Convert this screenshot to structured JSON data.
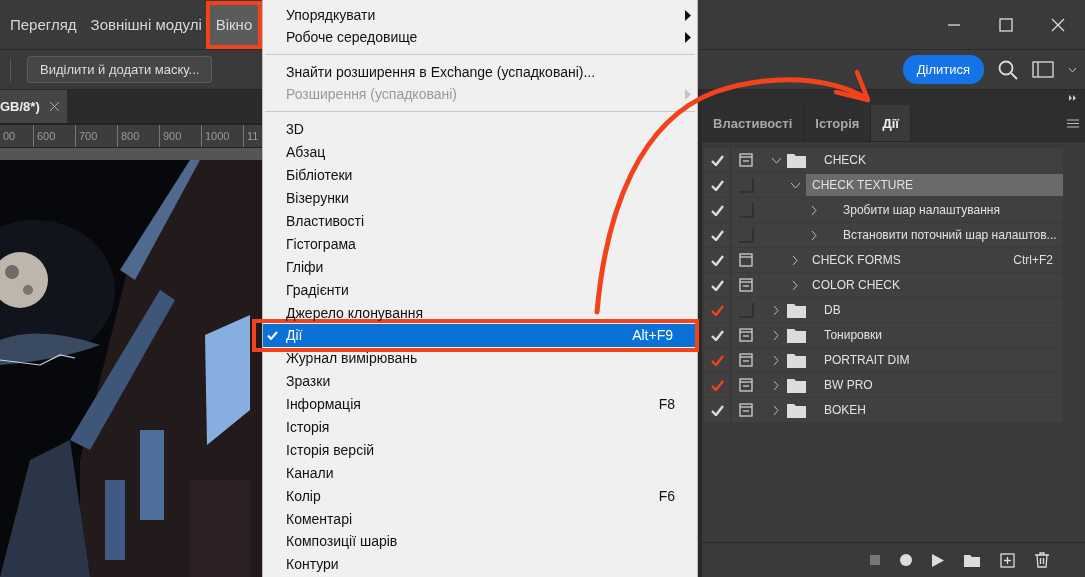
{
  "menubar": [
    {
      "label": "Перегляд",
      "open": false,
      "annotated": false
    },
    {
      "label": "Зовнішні модулі",
      "open": false,
      "annotated": false
    },
    {
      "label": "Вікно",
      "open": true,
      "annotated": true
    }
  ],
  "options_bar": {
    "mask_button": "Виділити й додати маску...",
    "share_button": "Ділитися"
  },
  "document_tab": {
    "title": "GB/8*)"
  },
  "ruler": {
    "labels": [
      "00",
      "600",
      "700",
      "800",
      "900",
      "1000",
      "11"
    ]
  },
  "panel": {
    "tabs": [
      {
        "label": "Властивості",
        "selected": false
      },
      {
        "label": "Історія",
        "selected": false
      },
      {
        "label": "Дії",
        "selected": true
      }
    ],
    "actions": [
      {
        "kind": "set",
        "name": "CHECK",
        "partially_enabled": false,
        "dialog_on": true,
        "dialog_mixed": true,
        "expanded": true,
        "selected": false,
        "children": [
          {
            "kind": "action",
            "name": "CHECK TEXTURE",
            "partially_enabled": false,
            "dialog_on": false,
            "expanded": true,
            "selected": true,
            "children": [
              {
                "kind": "step",
                "name": "Зробити шар налаштування",
                "partially_enabled": false,
                "dialog_on": false,
                "expanded": false,
                "selected": false
              },
              {
                "kind": "step",
                "name": "Встановити поточний шар налаштов...",
                "partially_enabled": false,
                "dialog_on": false,
                "expanded": false,
                "selected": false
              }
            ]
          },
          {
            "kind": "action",
            "name": "CHECK  FORMS",
            "shortcut": "Ctrl+F2",
            "partially_enabled": false,
            "dialog_on": true,
            "dialog_mixed": false,
            "expanded": false,
            "selected": false
          },
          {
            "kind": "action",
            "name": "COLOR CHECK",
            "partially_enabled": false,
            "dialog_on": true,
            "dialog_mixed": true,
            "expanded": false,
            "selected": false
          }
        ]
      },
      {
        "kind": "set",
        "name": "DB",
        "partially_enabled": true,
        "dialog_on": false,
        "expanded": false,
        "selected": false
      },
      {
        "kind": "set",
        "name": "Тонировки",
        "partially_enabled": false,
        "dialog_on": true,
        "dialog_mixed": true,
        "expanded": false,
        "selected": false
      },
      {
        "kind": "set",
        "name": "PORTRAIT DIM",
        "partially_enabled": true,
        "dialog_on": true,
        "dialog_mixed": true,
        "expanded": false,
        "selected": false
      },
      {
        "kind": "set",
        "name": "BW PRO",
        "partially_enabled": true,
        "dialog_on": true,
        "dialog_mixed": true,
        "expanded": false,
        "selected": false
      },
      {
        "kind": "set",
        "name": "BOKEH",
        "partially_enabled": false,
        "dialog_on": true,
        "dialog_mixed": true,
        "expanded": false,
        "selected": false
      }
    ]
  },
  "menu": {
    "groups": [
      [
        {
          "label": "Упорядкувати",
          "submenu": true,
          "disabled": false,
          "checked": false,
          "selected": false,
          "annotated": false
        },
        {
          "label": "Робоче середовище",
          "submenu": true,
          "disabled": false,
          "checked": false,
          "selected": false,
          "annotated": false
        }
      ],
      [
        {
          "label": "Знайти розширення в Exchange (успадковані)...",
          "submenu": false,
          "disabled": false,
          "checked": false,
          "selected": false,
          "annotated": false
        },
        {
          "label": "Розширення (успадковані)",
          "submenu": true,
          "disabled": true,
          "checked": false,
          "selected": false,
          "annotated": false
        }
      ],
      [
        {
          "label": "3D",
          "submenu": false,
          "disabled": false,
          "checked": false,
          "selected": false,
          "annotated": false
        },
        {
          "label": "Абзац",
          "submenu": false,
          "disabled": false,
          "checked": false,
          "selected": false,
          "annotated": false
        },
        {
          "label": "Бібліотеки",
          "submenu": false,
          "disabled": false,
          "checked": false,
          "selected": false,
          "annotated": false
        },
        {
          "label": "Візерунки",
          "submenu": false,
          "disabled": false,
          "checked": false,
          "selected": false,
          "annotated": false
        },
        {
          "label": "Властивості",
          "submenu": false,
          "disabled": false,
          "checked": false,
          "selected": false,
          "annotated": false
        },
        {
          "label": "Гістограма",
          "submenu": false,
          "disabled": false,
          "checked": false,
          "selected": false,
          "annotated": false
        },
        {
          "label": "Гліфи",
          "submenu": false,
          "disabled": false,
          "checked": false,
          "selected": false,
          "annotated": false
        },
        {
          "label": "Градієнти",
          "submenu": false,
          "disabled": false,
          "checked": false,
          "selected": false,
          "annotated": false
        },
        {
          "label": "Джерело клонування",
          "submenu": false,
          "disabled": false,
          "checked": false,
          "selected": false,
          "annotated": false
        },
        {
          "label": "Дії",
          "shortcut": "Alt+F9",
          "submenu": false,
          "disabled": false,
          "checked": true,
          "selected": true,
          "annotated": true
        },
        {
          "label": "Журнал вимірювань",
          "submenu": false,
          "disabled": false,
          "checked": false,
          "selected": false,
          "annotated": false
        },
        {
          "label": "Зразки",
          "submenu": false,
          "disabled": false,
          "checked": false,
          "selected": false,
          "annotated": false
        },
        {
          "label": "Інформація",
          "shortcut": "F8",
          "submenu": false,
          "disabled": false,
          "checked": false,
          "selected": false,
          "annotated": false
        },
        {
          "label": "Історія",
          "submenu": false,
          "disabled": false,
          "checked": false,
          "selected": false,
          "annotated": false
        },
        {
          "label": "Історія версій",
          "submenu": false,
          "disabled": false,
          "checked": false,
          "selected": false,
          "annotated": false
        },
        {
          "label": "Канали",
          "submenu": false,
          "disabled": false,
          "checked": false,
          "selected": false,
          "annotated": false
        },
        {
          "label": "Колір",
          "shortcut": "F6",
          "submenu": false,
          "disabled": false,
          "checked": false,
          "selected": false,
          "annotated": false
        },
        {
          "label": "Коментарі",
          "submenu": false,
          "disabled": false,
          "checked": false,
          "selected": false,
          "annotated": false
        },
        {
          "label": "Композиції шарів",
          "submenu": false,
          "disabled": false,
          "checked": false,
          "selected": false,
          "annotated": false
        },
        {
          "label": "Контури",
          "submenu": false,
          "disabled": false,
          "checked": false,
          "selected": false,
          "annotated": false
        }
      ]
    ]
  }
}
